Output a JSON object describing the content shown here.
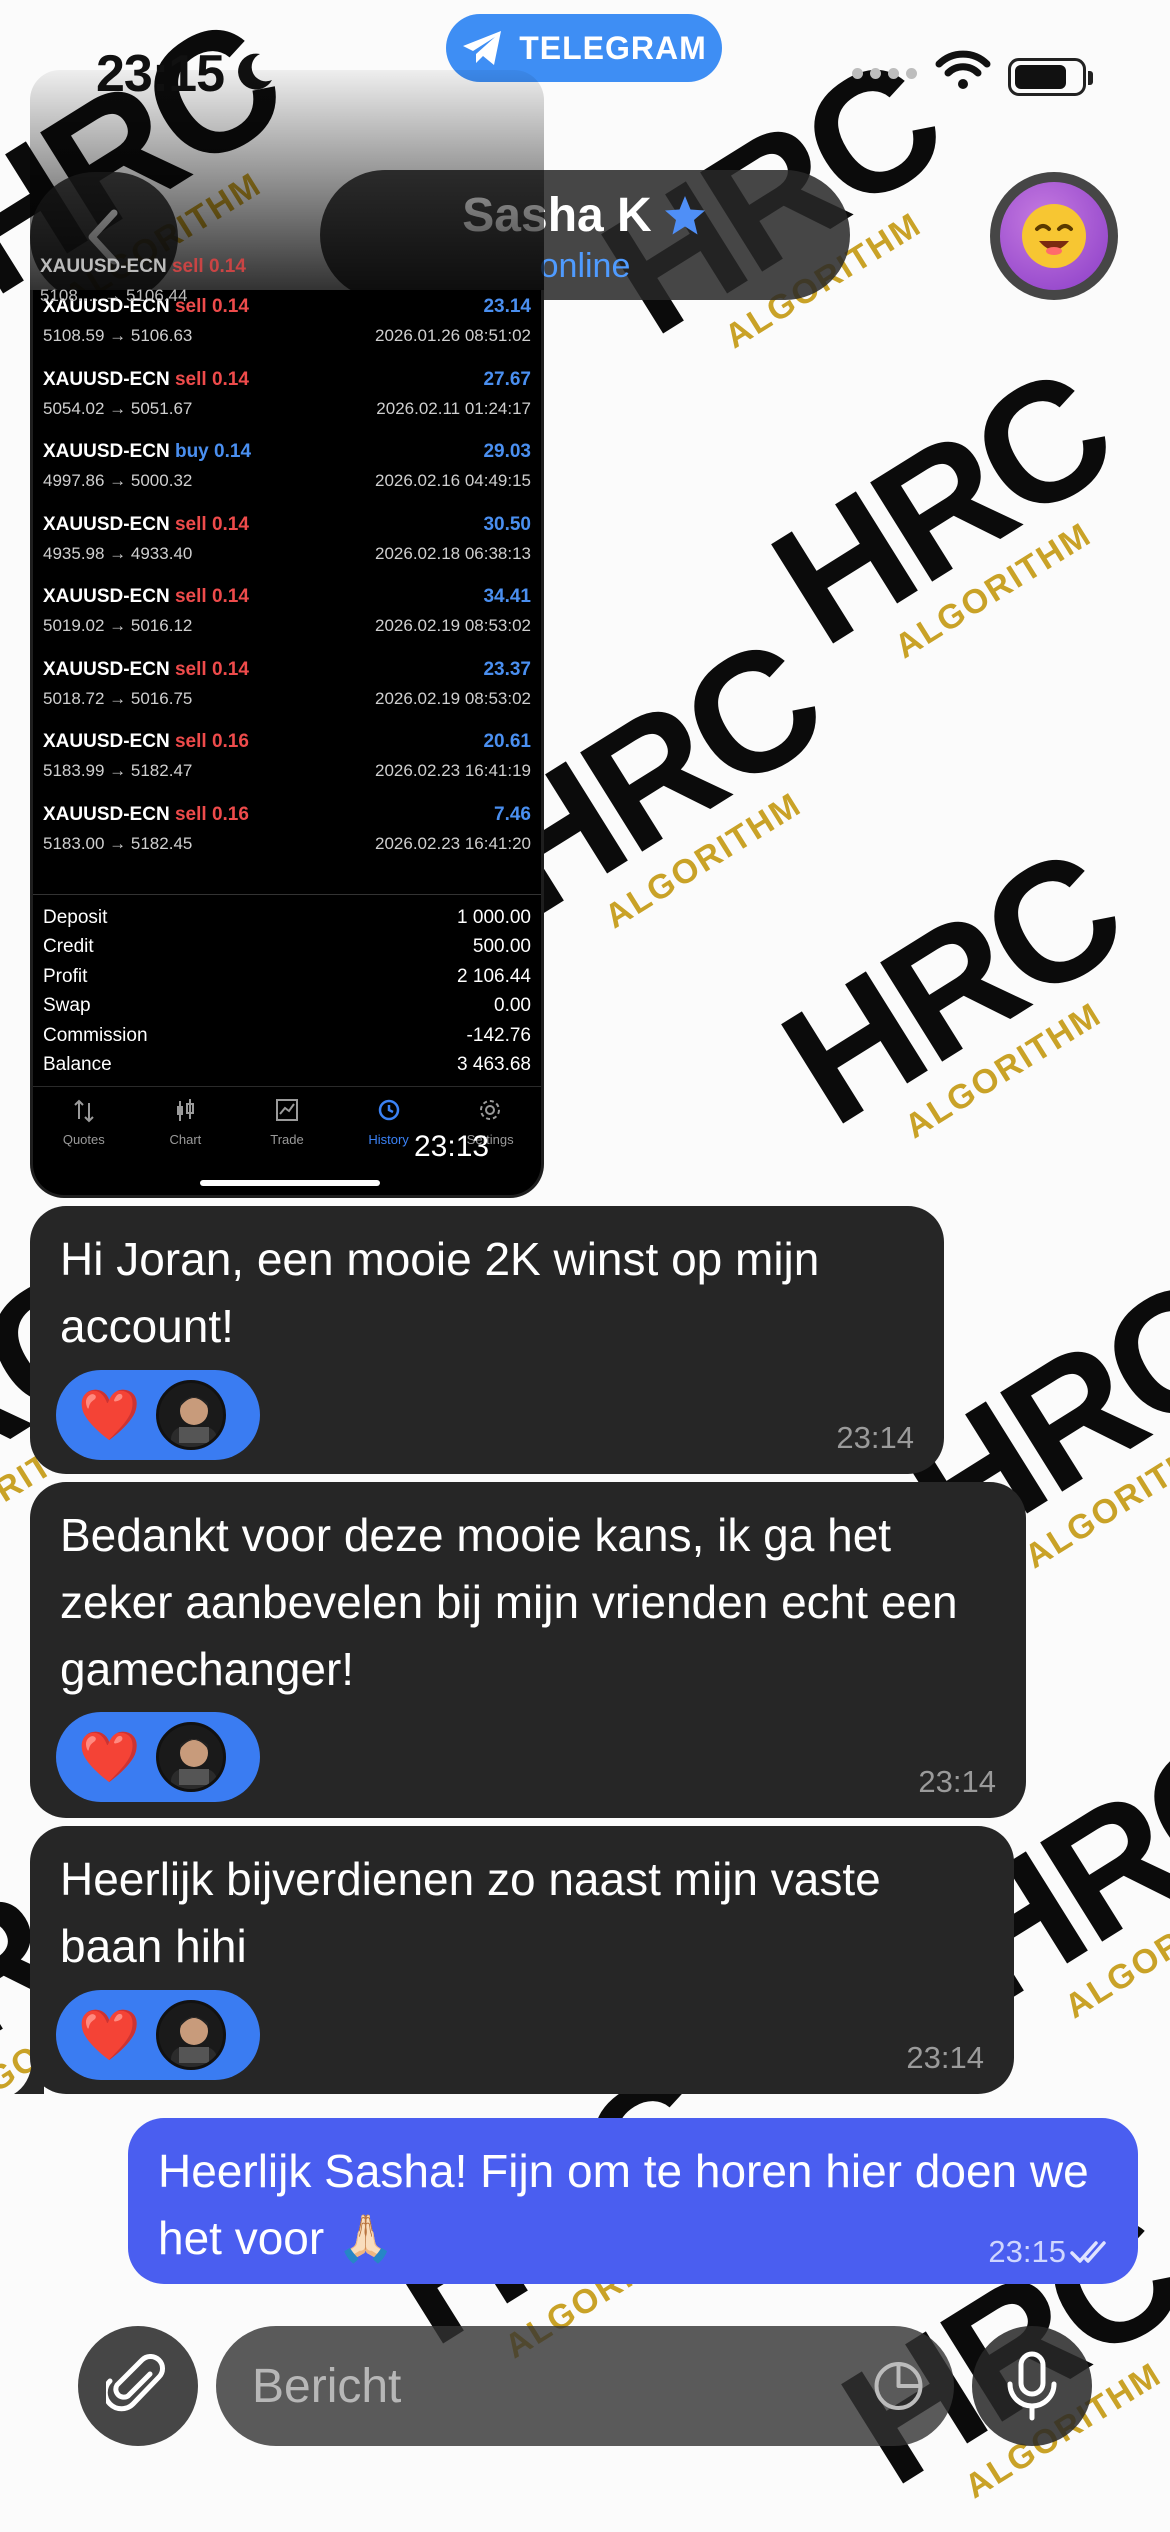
{
  "status_bar": {
    "time": "23:15",
    "app_badge": "TELEGRAM"
  },
  "header": {
    "contact_name": "Sasha K",
    "contact_status": "online"
  },
  "wallpaper": {
    "mark": "HRC",
    "sub": "ALGORITHM"
  },
  "screenshot": {
    "partial_row": {
      "symbol": "XAUUSD-ECN",
      "direction": "sell",
      "volume": "0.14",
      "prices": "5108.… → 5106.44"
    },
    "trades": [
      {
        "symbol": "XAUUSD-ECN",
        "direction": "sell",
        "volume": "0.14",
        "prices": "5108.59 → 5106.63",
        "profit": "23.14",
        "date": "2026.01.26 08:51:02"
      },
      {
        "symbol": "XAUUSD-ECN",
        "direction": "sell",
        "volume": "0.14",
        "prices": "5054.02 → 5051.67",
        "profit": "27.67",
        "date": "2026.02.11 01:24:17"
      },
      {
        "symbol": "XAUUSD-ECN",
        "direction": "buy",
        "volume": "0.14",
        "prices": "4997.86 → 5000.32",
        "profit": "29.03",
        "date": "2026.02.16 04:49:15"
      },
      {
        "symbol": "XAUUSD-ECN",
        "direction": "sell",
        "volume": "0.14",
        "prices": "4935.98 → 4933.40",
        "profit": "30.50",
        "date": "2026.02.18 06:38:13"
      },
      {
        "symbol": "XAUUSD-ECN",
        "direction": "sell",
        "volume": "0.14",
        "prices": "5019.02 → 5016.12",
        "profit": "34.41",
        "date": "2026.02.19 08:53:02"
      },
      {
        "symbol": "XAUUSD-ECN",
        "direction": "sell",
        "volume": "0.14",
        "prices": "5018.72 → 5016.75",
        "profit": "23.37",
        "date": "2026.02.19 08:53:02"
      },
      {
        "symbol": "XAUUSD-ECN",
        "direction": "sell",
        "volume": "0.16",
        "prices": "5183.99 → 5182.47",
        "profit": "20.61",
        "date": "2026.02.23 16:41:19"
      },
      {
        "symbol": "XAUUSD-ECN",
        "direction": "sell",
        "volume": "0.16",
        "prices": "5183.00 → 5182.45",
        "profit": "7.46",
        "date": "2026.02.23 16:41:20"
      }
    ],
    "summary": [
      {
        "label": "Deposit",
        "value": "1 000.00"
      },
      {
        "label": "Credit",
        "value": "500.00"
      },
      {
        "label": "Profit",
        "value": "2 106.44"
      },
      {
        "label": "Swap",
        "value": "0.00"
      },
      {
        "label": "Commission",
        "value": "-142.76"
      },
      {
        "label": "Balance",
        "value": "3 463.68"
      }
    ],
    "tabs": [
      "Quotes",
      "Chart",
      "Trade",
      "History",
      "Settings"
    ],
    "active_tab": "History",
    "time": "23:13"
  },
  "messages": [
    {
      "text": "Hi Joran, een mooie 2K winst op mijn account!",
      "time": "23:14",
      "reaction": "❤️"
    },
    {
      "text": "Bedankt voor deze mooie kans, ik ga het zeker aanbevelen bij mijn vrienden echt een gamechanger!",
      "time": "23:14",
      "reaction": "❤️"
    },
    {
      "text": "Heerlijk bijverdienen zo naast mijn vaste baan hihi",
      "time": "23:14",
      "reaction": "❤️"
    },
    {
      "text": "Heerlijk Sasha! Fijn om te horen hier doen we het voor 🙏🏻",
      "time": "23:15"
    }
  ],
  "composer": {
    "placeholder": "Bericht"
  },
  "colors": {
    "telegram_blue": "#3e8ef4",
    "outgoing_bubble": "#4a5ef0",
    "incoming_bubble": "#262626",
    "reaction_pill": "#3a7cf2",
    "profit_blue": "#4a8ff0",
    "sell_red": "#ee4b4b"
  },
  "icons": [
    "back-chevron-icon",
    "verified-star-icon",
    "telegram-plane-icon",
    "moon-icon",
    "wifi-icon",
    "battery-icon",
    "paperclip-icon",
    "sticker-icon",
    "microphone-icon",
    "double-check-icon"
  ]
}
